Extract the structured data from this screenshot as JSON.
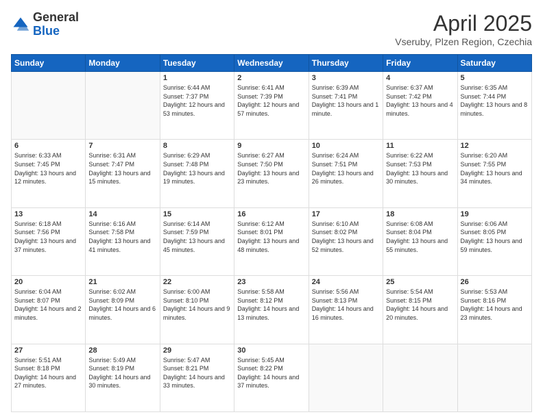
{
  "header": {
    "logo_general": "General",
    "logo_blue": "Blue",
    "month_title": "April 2025",
    "location": "Vseruby, Plzen Region, Czechia"
  },
  "days_of_week": [
    "Sunday",
    "Monday",
    "Tuesday",
    "Wednesday",
    "Thursday",
    "Friday",
    "Saturday"
  ],
  "weeks": [
    [
      {
        "day": "",
        "info": ""
      },
      {
        "day": "",
        "info": ""
      },
      {
        "day": "1",
        "info": "Sunrise: 6:44 AM\nSunset: 7:37 PM\nDaylight: 12 hours and 53 minutes."
      },
      {
        "day": "2",
        "info": "Sunrise: 6:41 AM\nSunset: 7:39 PM\nDaylight: 12 hours and 57 minutes."
      },
      {
        "day": "3",
        "info": "Sunrise: 6:39 AM\nSunset: 7:41 PM\nDaylight: 13 hours and 1 minute."
      },
      {
        "day": "4",
        "info": "Sunrise: 6:37 AM\nSunset: 7:42 PM\nDaylight: 13 hours and 4 minutes."
      },
      {
        "day": "5",
        "info": "Sunrise: 6:35 AM\nSunset: 7:44 PM\nDaylight: 13 hours and 8 minutes."
      }
    ],
    [
      {
        "day": "6",
        "info": "Sunrise: 6:33 AM\nSunset: 7:45 PM\nDaylight: 13 hours and 12 minutes."
      },
      {
        "day": "7",
        "info": "Sunrise: 6:31 AM\nSunset: 7:47 PM\nDaylight: 13 hours and 15 minutes."
      },
      {
        "day": "8",
        "info": "Sunrise: 6:29 AM\nSunset: 7:48 PM\nDaylight: 13 hours and 19 minutes."
      },
      {
        "day": "9",
        "info": "Sunrise: 6:27 AM\nSunset: 7:50 PM\nDaylight: 13 hours and 23 minutes."
      },
      {
        "day": "10",
        "info": "Sunrise: 6:24 AM\nSunset: 7:51 PM\nDaylight: 13 hours and 26 minutes."
      },
      {
        "day": "11",
        "info": "Sunrise: 6:22 AM\nSunset: 7:53 PM\nDaylight: 13 hours and 30 minutes."
      },
      {
        "day": "12",
        "info": "Sunrise: 6:20 AM\nSunset: 7:55 PM\nDaylight: 13 hours and 34 minutes."
      }
    ],
    [
      {
        "day": "13",
        "info": "Sunrise: 6:18 AM\nSunset: 7:56 PM\nDaylight: 13 hours and 37 minutes."
      },
      {
        "day": "14",
        "info": "Sunrise: 6:16 AM\nSunset: 7:58 PM\nDaylight: 13 hours and 41 minutes."
      },
      {
        "day": "15",
        "info": "Sunrise: 6:14 AM\nSunset: 7:59 PM\nDaylight: 13 hours and 45 minutes."
      },
      {
        "day": "16",
        "info": "Sunrise: 6:12 AM\nSunset: 8:01 PM\nDaylight: 13 hours and 48 minutes."
      },
      {
        "day": "17",
        "info": "Sunrise: 6:10 AM\nSunset: 8:02 PM\nDaylight: 13 hours and 52 minutes."
      },
      {
        "day": "18",
        "info": "Sunrise: 6:08 AM\nSunset: 8:04 PM\nDaylight: 13 hours and 55 minutes."
      },
      {
        "day": "19",
        "info": "Sunrise: 6:06 AM\nSunset: 8:05 PM\nDaylight: 13 hours and 59 minutes."
      }
    ],
    [
      {
        "day": "20",
        "info": "Sunrise: 6:04 AM\nSunset: 8:07 PM\nDaylight: 14 hours and 2 minutes."
      },
      {
        "day": "21",
        "info": "Sunrise: 6:02 AM\nSunset: 8:09 PM\nDaylight: 14 hours and 6 minutes."
      },
      {
        "day": "22",
        "info": "Sunrise: 6:00 AM\nSunset: 8:10 PM\nDaylight: 14 hours and 9 minutes."
      },
      {
        "day": "23",
        "info": "Sunrise: 5:58 AM\nSunset: 8:12 PM\nDaylight: 14 hours and 13 minutes."
      },
      {
        "day": "24",
        "info": "Sunrise: 5:56 AM\nSunset: 8:13 PM\nDaylight: 14 hours and 16 minutes."
      },
      {
        "day": "25",
        "info": "Sunrise: 5:54 AM\nSunset: 8:15 PM\nDaylight: 14 hours and 20 minutes."
      },
      {
        "day": "26",
        "info": "Sunrise: 5:53 AM\nSunset: 8:16 PM\nDaylight: 14 hours and 23 minutes."
      }
    ],
    [
      {
        "day": "27",
        "info": "Sunrise: 5:51 AM\nSunset: 8:18 PM\nDaylight: 14 hours and 27 minutes."
      },
      {
        "day": "28",
        "info": "Sunrise: 5:49 AM\nSunset: 8:19 PM\nDaylight: 14 hours and 30 minutes."
      },
      {
        "day": "29",
        "info": "Sunrise: 5:47 AM\nSunset: 8:21 PM\nDaylight: 14 hours and 33 minutes."
      },
      {
        "day": "30",
        "info": "Sunrise: 5:45 AM\nSunset: 8:22 PM\nDaylight: 14 hours and 37 minutes."
      },
      {
        "day": "",
        "info": ""
      },
      {
        "day": "",
        "info": ""
      },
      {
        "day": "",
        "info": ""
      }
    ]
  ]
}
